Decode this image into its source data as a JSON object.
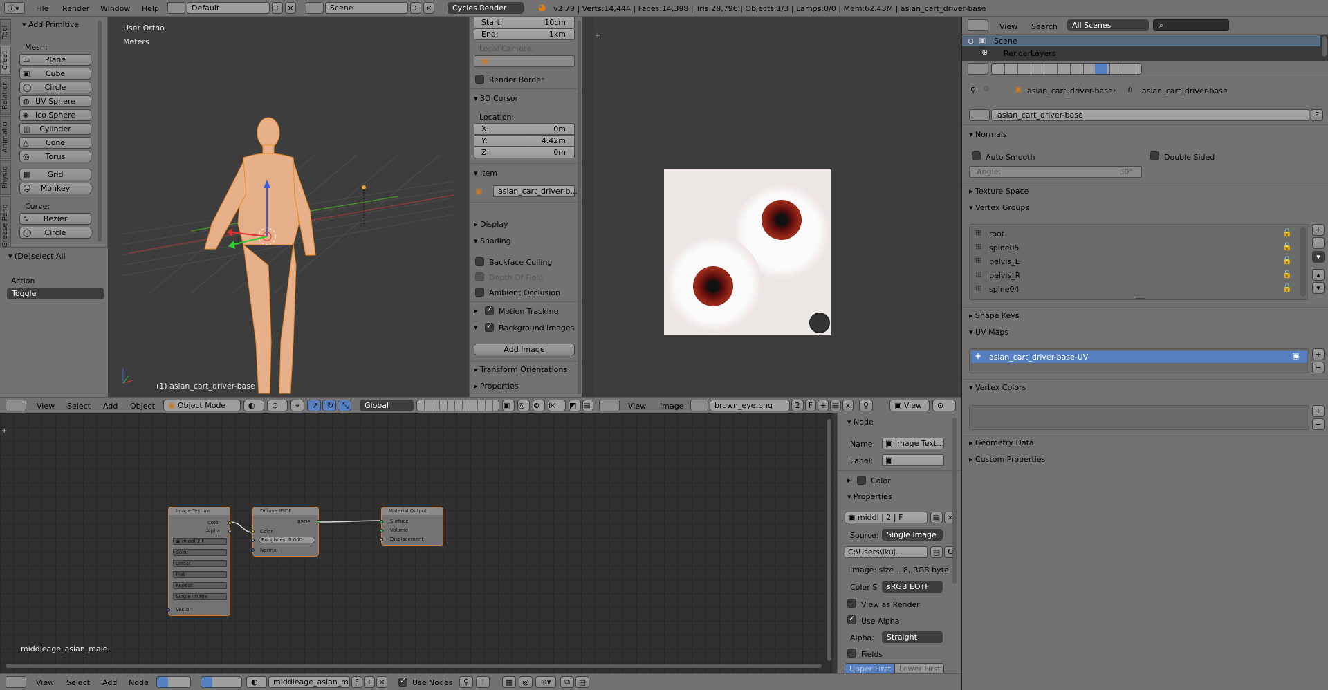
{
  "topbar": {
    "menus": [
      "File",
      "Render",
      "Window",
      "Help"
    ],
    "screen_layout": "Default",
    "scene": "Scene",
    "engine": "Cycles Render",
    "stats": "v2.79 | Verts:14,444 | Faces:14,398 | Tris:28,796 | Objects:1/3 | Lamps:0/0 | Mem:62.43M | asian_cart_driver-base"
  },
  "toolshelf": {
    "tabs": [
      "Tool",
      "Creat",
      "Relation",
      "Animatio",
      "Physic",
      "Grease Penc"
    ],
    "panel_title": "Add Primitive",
    "mesh_label": "Mesh:",
    "mesh_items": [
      "Plane",
      "Cube",
      "Circle",
      "UV Sphere",
      "Ico Sphere",
      "Cylinder",
      "Cone",
      "Torus"
    ],
    "mesh_items2": [
      "Grid",
      "Monkey"
    ],
    "curve_label": "Curve:",
    "curve_items": [
      "Bezier",
      "Circle"
    ],
    "operator_title": "(De)select All",
    "action_label": "Action",
    "action_value": "Toggle"
  },
  "viewport": {
    "view_name": "User Ortho",
    "units": "Meters",
    "object_label": "(1) asian_cart_driver-base"
  },
  "nprops": {
    "clip_start_label": "Start:",
    "clip_start": "10cm",
    "clip_end_label": "End:",
    "clip_end": "1km",
    "local_camera": "Local Camera:",
    "render_border": "Render Border",
    "cursor_title": "3D Cursor",
    "location": "Location:",
    "x_label": "X:",
    "x": "0m",
    "y_label": "Y:",
    "y": "4.42m",
    "z_label": "Z:",
    "z": "0m",
    "item_title": "Item",
    "item_name": "asian_cart_driver-b...",
    "display_title": "Display",
    "shading_title": "Shading",
    "backface": "Backface Culling",
    "dof": "Depth Of Field",
    "ao": "Ambient Occlusion",
    "motion_tracking": "Motion Tracking",
    "bg_images": "Background Images",
    "add_image": "Add Image",
    "transform_orient": "Transform Orientations",
    "properties": "Properties"
  },
  "viewport_header": {
    "menus": [
      "View",
      "Select",
      "Add",
      "Object"
    ],
    "mode": "Object Mode",
    "orientation": "Global"
  },
  "image_editor_header": {
    "menus": [
      "View",
      "Image"
    ],
    "image_name": "brown_eye.png",
    "users": "2",
    "fake": "F",
    "view": "View"
  },
  "outliner": {
    "menus": [
      "View",
      "Search"
    ],
    "scenes": "All Scenes",
    "rows": [
      "Scene",
      "RenderLayers"
    ]
  },
  "properties": {
    "breadcrumb": [
      "asian_cart_driver-base",
      "asian_cart_driver-base"
    ],
    "datablock": "asian_cart_driver-base",
    "fake": "F",
    "normals_title": "Normals",
    "auto_smooth": "Auto Smooth",
    "double_sided": "Double Sided",
    "angle_label": "Angle:",
    "angle_value": "30°",
    "texture_space": "Texture Space",
    "vertex_groups": "Vertex Groups",
    "groups": [
      "root",
      "spine05",
      "pelvis_L",
      "pelvis_R",
      "spine04"
    ],
    "shape_keys": "Shape Keys",
    "uv_maps": "UV Maps",
    "uv_map_name": "asian_cart_driver-base-UV",
    "vertex_colors": "Vertex Colors",
    "geometry_data": "Geometry Data",
    "custom_properties": "Custom Properties"
  },
  "nodes": {
    "material_name": "middleage_asian_male",
    "image_texture": {
      "title": "Image Texture",
      "out_color": "Color",
      "out_alpha": "Alpha",
      "img": "middl",
      "users": "2",
      "fake": "F",
      "color": "Color",
      "interp": "Linear",
      "proj": "Flat",
      "ext": "Repeat",
      "source": "Single Image",
      "vector": "Vector"
    },
    "diffuse": {
      "title": "Diffuse BSDF",
      "bsdf": "BSDF",
      "color": "Color",
      "roughness": "Roughnes: 0.000",
      "normal": "Normal"
    },
    "output": {
      "title": "Material Output",
      "surface": "Surface",
      "volume": "Volume",
      "displacement": "Displacement"
    }
  },
  "node_sidebar": {
    "node_title": "Node",
    "name_label": "Name:",
    "name_value": "Image Text...",
    "label_label": "Label:",
    "color_title": "Color",
    "properties_title": "Properties",
    "img_name": "middl",
    "users": "2",
    "fake": "F",
    "source_label": "Source:",
    "source_value": "Single Image",
    "path": "C:\\Users\\ikuj...",
    "image_info": "Image: size ...8, RGB byte",
    "colorspace_label": "Color S",
    "colorspace_value": "sRGB EOTF",
    "view_as_render": "View as Render",
    "use_alpha": "Use Alpha",
    "alpha_label": "Alpha:",
    "alpha_value": "Straight",
    "fields": "Fields",
    "upper_first": "Upper First",
    "lower_first": "Lower First"
  },
  "node_header": {
    "menus": [
      "View",
      "Select",
      "Add",
      "Node"
    ],
    "material": "middleage_asian_m...",
    "fake": "F",
    "use_nodes": "Use Nodes"
  }
}
